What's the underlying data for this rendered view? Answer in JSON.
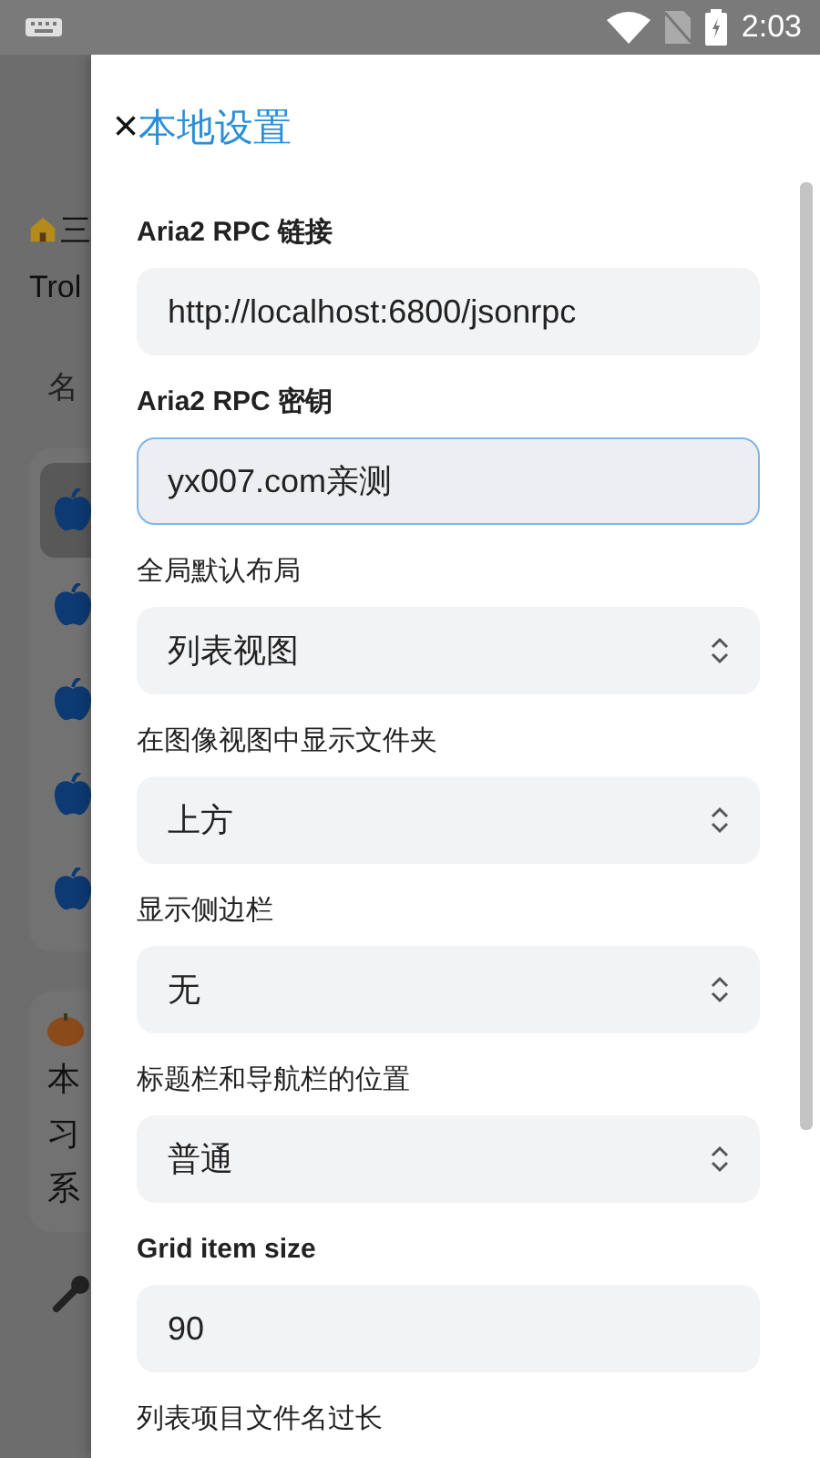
{
  "status_bar": {
    "time": "2:03"
  },
  "background": {
    "header": "三",
    "app_name": "Trol",
    "column_header": "名",
    "rows": [
      {
        "selected": true
      },
      {
        "selected": false
      },
      {
        "selected": false
      },
      {
        "selected": false
      },
      {
        "selected": false
      }
    ],
    "notes": [
      "本",
      "习",
      "系"
    ]
  },
  "drawer": {
    "close": "×",
    "title": "本地设置",
    "fields": [
      {
        "kind": "input",
        "label": "Aria2 RPC 链接",
        "bold": true,
        "value": "http://localhost:6800/jsonrpc",
        "focused": false
      },
      {
        "kind": "input",
        "label": "Aria2 RPC 密钥",
        "bold": true,
        "value": "yx007.com亲测",
        "focused": true
      },
      {
        "kind": "select",
        "label": "全局默认布局",
        "bold": false,
        "value": "列表视图",
        "focused": false
      },
      {
        "kind": "select",
        "label": "在图像视图中显示文件夹",
        "bold": false,
        "value": "上方",
        "focused": false
      },
      {
        "kind": "select",
        "label": "显示侧边栏",
        "bold": false,
        "value": "无",
        "focused": false
      },
      {
        "kind": "select",
        "label": "标题栏和导航栏的位置",
        "bold": false,
        "value": "普通",
        "focused": false
      },
      {
        "kind": "input",
        "label": "Grid item size",
        "bold": true,
        "value": "90",
        "focused": false
      },
      {
        "kind": "label",
        "label": "列表项目文件名过长",
        "bold": false
      }
    ]
  }
}
